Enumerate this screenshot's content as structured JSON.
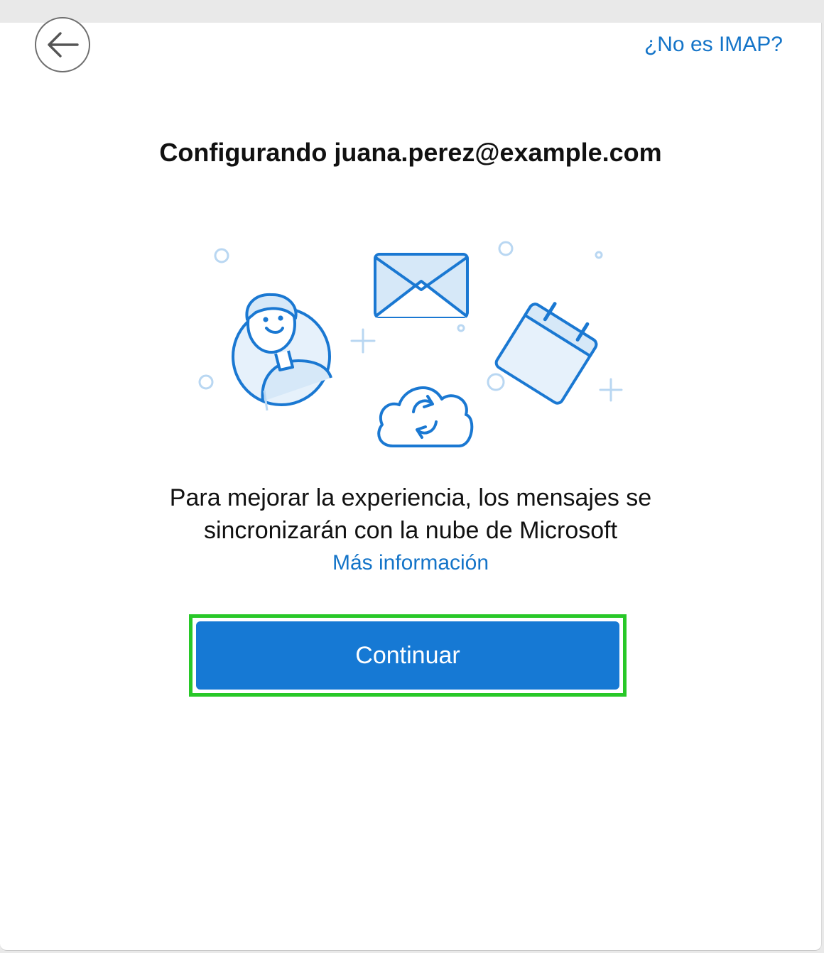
{
  "header": {
    "back_icon": "arrow-left-icon",
    "not_imap_link": "¿No es IMAP?"
  },
  "main": {
    "title": "Configurando juana.perez@example.com",
    "description_line1": "Para mejorar la experiencia, los mensajes se",
    "description_line2": "sincronizarán con la nube de Microsoft",
    "more_info_link": "Más información",
    "continue_label": "Continuar"
  },
  "colors": {
    "accent": "#1679d4",
    "link": "#1474c8",
    "illustration_stroke": "#1a78d2",
    "illustration_fill": "#d6e8f8",
    "highlight": "#28c828"
  }
}
